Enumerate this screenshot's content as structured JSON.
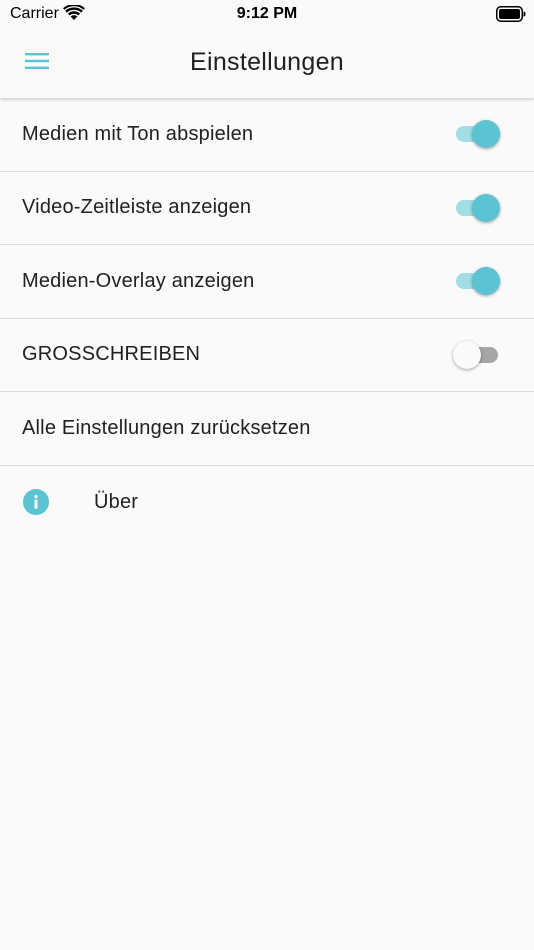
{
  "status_bar": {
    "carrier": "Carrier",
    "time": "9:12 PM"
  },
  "app_bar": {
    "title": "Einstellungen",
    "menu_icon": "hamburger-menu-icon"
  },
  "settings": [
    {
      "label": "Medien mit Ton abspielen",
      "enabled": true
    },
    {
      "label": "Video-Zeitleiste anzeigen",
      "enabled": true
    },
    {
      "label": "Medien-Overlay anzeigen",
      "enabled": true
    },
    {
      "label": "GROSSCHREIBEN",
      "enabled": false
    }
  ],
  "reset": {
    "label": "Alle Einstellungen zurücksetzen"
  },
  "about": {
    "label": "Über",
    "icon": "info-icon"
  },
  "colors": {
    "accent": "#5bc3d1",
    "accent_track": "#a3dde5",
    "off_track": "#a6a6a6",
    "background": "#fafafa"
  }
}
